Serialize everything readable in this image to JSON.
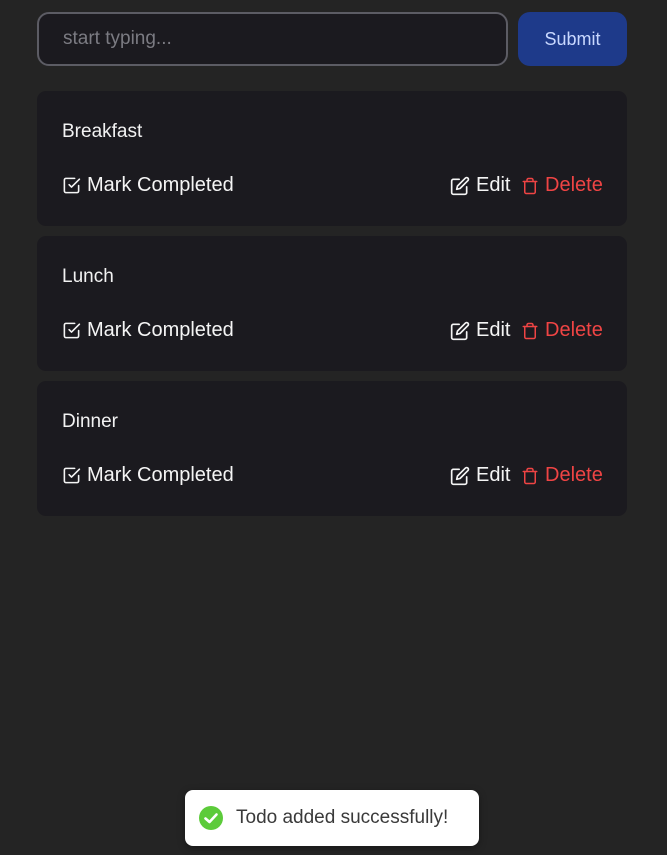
{
  "form": {
    "input_value": "",
    "input_placeholder": "start typing...",
    "submit_label": "Submit"
  },
  "todos": [
    {
      "title": "Breakfast",
      "mark_label": "Mark Completed",
      "edit_label": "Edit",
      "delete_label": "Delete"
    },
    {
      "title": "Lunch",
      "mark_label": "Mark Completed",
      "edit_label": "Edit",
      "delete_label": "Delete"
    },
    {
      "title": "Dinner",
      "mark_label": "Mark Completed",
      "edit_label": "Edit",
      "delete_label": "Delete"
    }
  ],
  "toast": {
    "message": "Todo added successfully!",
    "icon": "check-circle-icon"
  },
  "icons": {
    "mark": "check-square-icon",
    "edit": "edit-icon",
    "delete": "trash-icon"
  },
  "colors": {
    "background": "#242424",
    "card": "#1b1a1f",
    "submit_button": "#1e3a8a",
    "submit_text": "#c9d8ff",
    "delete": "#ef4444",
    "toast_success": "#5ccb3a"
  }
}
